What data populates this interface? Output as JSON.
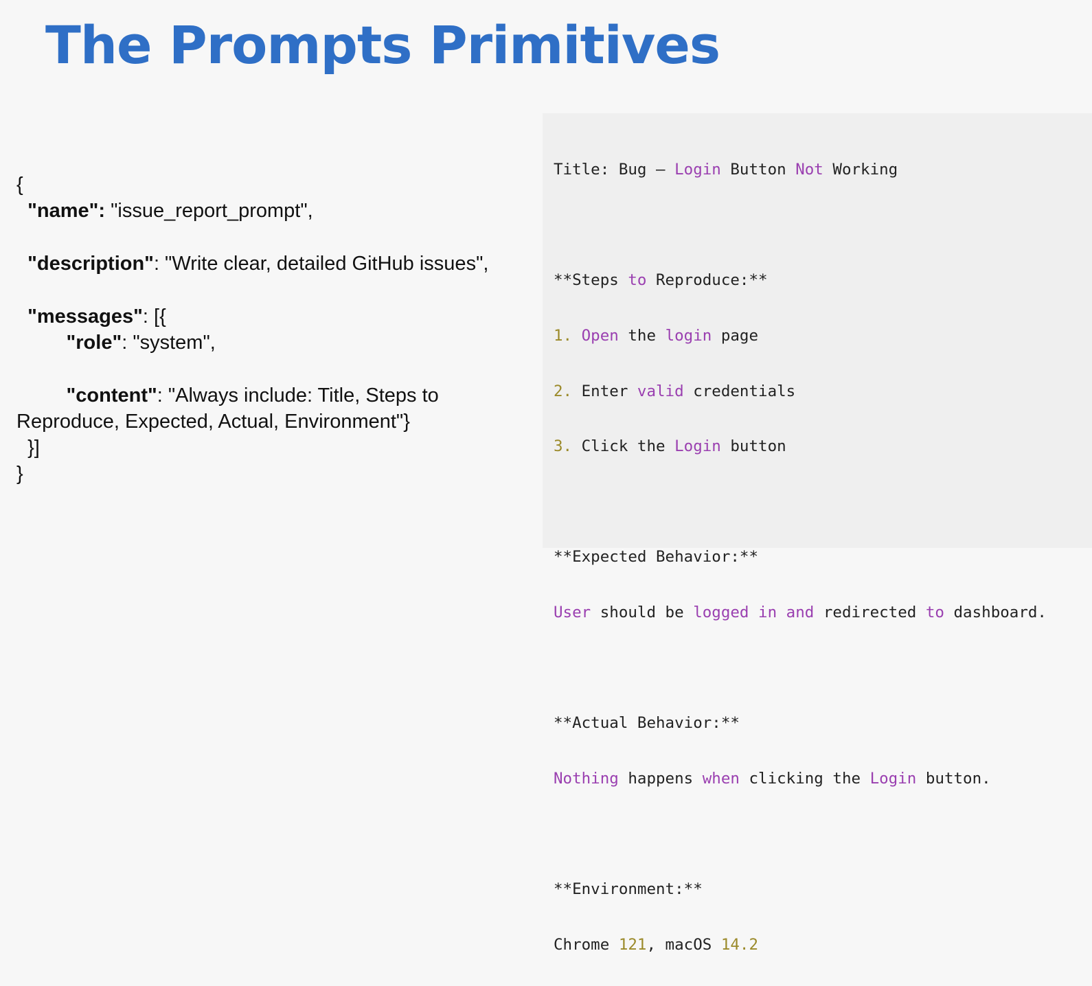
{
  "slide": {
    "title": "The Prompts Primitives"
  },
  "json_block": {
    "open_brace": "{",
    "name_key": "\"name\":",
    "name_value": " \"issue_report_prompt\",",
    "description_key": "\"description\"",
    "description_value": ": \"Write clear, detailed GitHub issues\",",
    "messages_key": "\"messages\"",
    "messages_value": ": [{",
    "role_key": "\"role\"",
    "role_value": ": \"system\",",
    "content_key": "\"content\"",
    "content_value": ": \"Always include: Title, Steps to",
    "content_continuation": "Reproduce, Expected, Actual, Environment\"}",
    "close_array": "}]",
    "close_brace": "}"
  },
  "code_panel": {
    "line_title": {
      "t1": "Title: Bug — ",
      "t2": "Login",
      "t3": " Button ",
      "t4": "Not",
      "t5": " Working"
    },
    "line_steps_heading": {
      "t1": "**Steps ",
      "t2": "to",
      "t3": " Reproduce:**"
    },
    "step1": {
      "num": "1.",
      "t1": " ",
      "t2": "Open",
      "t3": " the ",
      "t4": "login",
      "t5": " page"
    },
    "step2": {
      "num": "2.",
      "t1": " Enter ",
      "t2": "valid",
      "t3": " credentials"
    },
    "step3": {
      "num": "3.",
      "t1": " Click the ",
      "t2": "Login",
      "t3": " button"
    },
    "expected_heading": "**Expected Behavior:**",
    "expected_line": {
      "t1": "User",
      "t2": " should be ",
      "t3": "logged",
      "t4": " ",
      "t5": "in",
      "t6": " ",
      "t7": "and",
      "t8": " redirected ",
      "t9": "to",
      "t10": " dashboard."
    },
    "actual_heading": "**Actual Behavior:**",
    "actual_line": {
      "t1": "Nothing",
      "t2": " happens ",
      "t3": "when",
      "t4": " clicking the ",
      "t5": "Login",
      "t6": " button."
    },
    "environment_heading": "**Environment:**",
    "environment_line": {
      "t1": "Chrome ",
      "t2": "121",
      "t3": ", macOS ",
      "t4": "14.2"
    }
  },
  "colors": {
    "title_blue": "#2f6fc6",
    "keyword_purple": "#9a3fb0",
    "number_olive": "#9b8a2a",
    "panel_bg": "#efefef",
    "page_bg": "#f7f7f7"
  }
}
